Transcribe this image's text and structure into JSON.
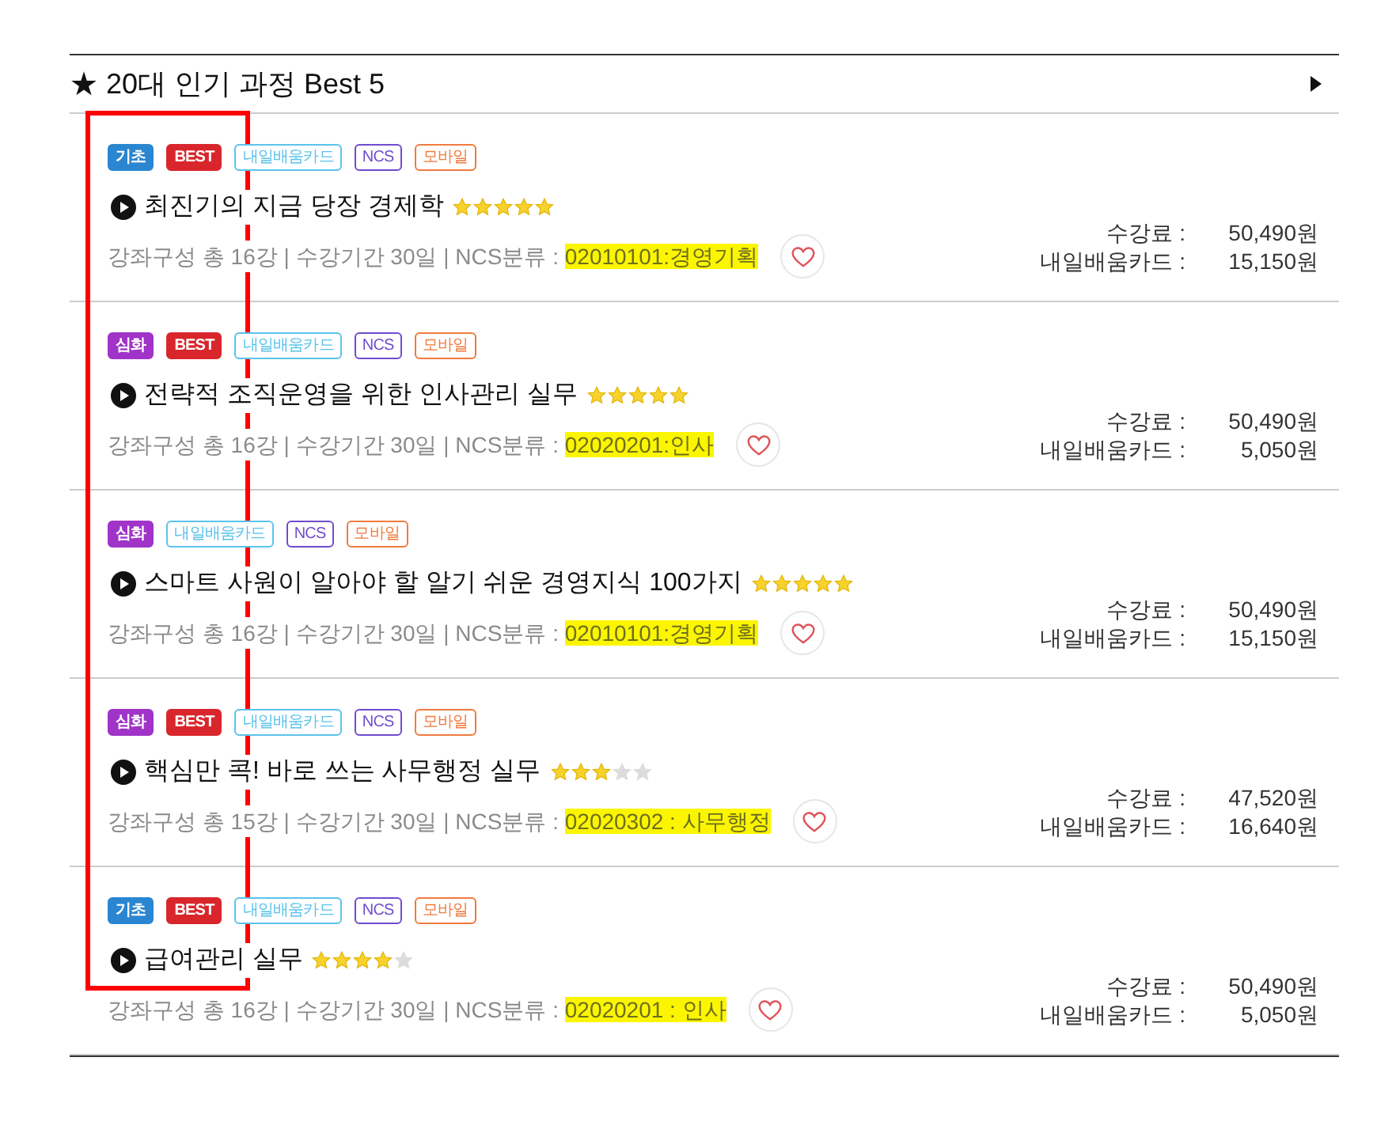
{
  "section": {
    "title": "★ 20대 인기 과정 Best 5"
  },
  "courses": [
    {
      "badges": [
        {
          "label": "기초",
          "kind": "filled",
          "color": "#2a86d1"
        },
        {
          "label": "BEST",
          "kind": "filled",
          "color": "#d9262c"
        },
        {
          "label": "내일배움카드",
          "kind": "outline",
          "color": "#5bc3eb"
        },
        {
          "label": "NCS",
          "kind": "outline",
          "color": "#6f4ccf"
        },
        {
          "label": "모바일",
          "kind": "outline",
          "color": "#f07b3f"
        }
      ],
      "title": "최진기의 지금 당장 경제학",
      "stars": 5,
      "info": "강좌구성 총 16강 | 수강기간 30일 | NCS분류 : ",
      "ncs": "02010101:경영기획",
      "highlighted": true,
      "prices": [
        {
          "label": "수강료 :",
          "value": "50,490원"
        },
        {
          "label": "내일배움카드 :",
          "value": "15,150원"
        }
      ]
    },
    {
      "badges": [
        {
          "label": "심화",
          "kind": "filled",
          "color": "#a033c8"
        },
        {
          "label": "BEST",
          "kind": "filled",
          "color": "#d9262c"
        },
        {
          "label": "내일배움카드",
          "kind": "outline",
          "color": "#5bc3eb"
        },
        {
          "label": "NCS",
          "kind": "outline",
          "color": "#6f4ccf"
        },
        {
          "label": "모바일",
          "kind": "outline",
          "color": "#f07b3f"
        }
      ],
      "title": "전략적 조직운영을 위한 인사관리 실무",
      "stars": 5,
      "info": "강좌구성 총 16강 | 수강기간 30일 | NCS분류 : ",
      "ncs": "02020201:인사",
      "highlighted": true,
      "prices": [
        {
          "label": "수강료 :",
          "value": "50,490원"
        },
        {
          "label": "내일배움카드 :",
          "value": "5,050원"
        }
      ]
    },
    {
      "badges": [
        {
          "label": "심화",
          "kind": "filled",
          "color": "#a033c8"
        },
        {
          "label": "내일배움카드",
          "kind": "outline",
          "color": "#5bc3eb"
        },
        {
          "label": "NCS",
          "kind": "outline",
          "color": "#6f4ccf"
        },
        {
          "label": "모바일",
          "kind": "outline",
          "color": "#f07b3f"
        }
      ],
      "title": "스마트 사원이 알아야 할 알기 쉬운 경영지식 100가지",
      "stars": 5,
      "info": "강좌구성 총 16강 | 수강기간 30일 | NCS분류 : ",
      "ncs": "02010101:경영기획",
      "highlighted": true,
      "prices": [
        {
          "label": "수강료 :",
          "value": "50,490원"
        },
        {
          "label": "내일배움카드 :",
          "value": "15,150원"
        }
      ]
    },
    {
      "badges": [
        {
          "label": "심화",
          "kind": "filled",
          "color": "#a033c8"
        },
        {
          "label": "BEST",
          "kind": "filled",
          "color": "#d9262c"
        },
        {
          "label": "내일배움카드",
          "kind": "outline",
          "color": "#5bc3eb"
        },
        {
          "label": "NCS",
          "kind": "outline",
          "color": "#6f4ccf"
        },
        {
          "label": "모바일",
          "kind": "outline",
          "color": "#f07b3f"
        }
      ],
      "title": "핵심만 콕! 바로 쓰는 사무행정 실무",
      "stars": 3,
      "info": "강좌구성 총 15강 | 수강기간 30일 | NCS분류 : ",
      "ncs": "02020302 : 사무행정",
      "highlighted": true,
      "prices": [
        {
          "label": "수강료 :",
          "value": "47,520원"
        },
        {
          "label": "내일배움카드 :",
          "value": "16,640원"
        }
      ]
    },
    {
      "badges": [
        {
          "label": "기초",
          "kind": "filled",
          "color": "#2a86d1"
        },
        {
          "label": "BEST",
          "kind": "filled",
          "color": "#d9262c"
        },
        {
          "label": "내일배움카드",
          "kind": "outline",
          "color": "#5bc3eb"
        },
        {
          "label": "NCS",
          "kind": "outline",
          "color": "#6f4ccf"
        },
        {
          "label": "모바일",
          "kind": "outline",
          "color": "#f07b3f"
        }
      ],
      "title": "급여관리 실무",
      "stars": 4,
      "info": "강좌구성 총 16강 | 수강기간 30일 | NCS분류 : ",
      "ncs": "02020201 : 인사",
      "highlighted": true,
      "prices": [
        {
          "label": "수강료 :",
          "value": "50,490원"
        },
        {
          "label": "내일배움카드 :",
          "value": "5,050원"
        }
      ]
    }
  ]
}
